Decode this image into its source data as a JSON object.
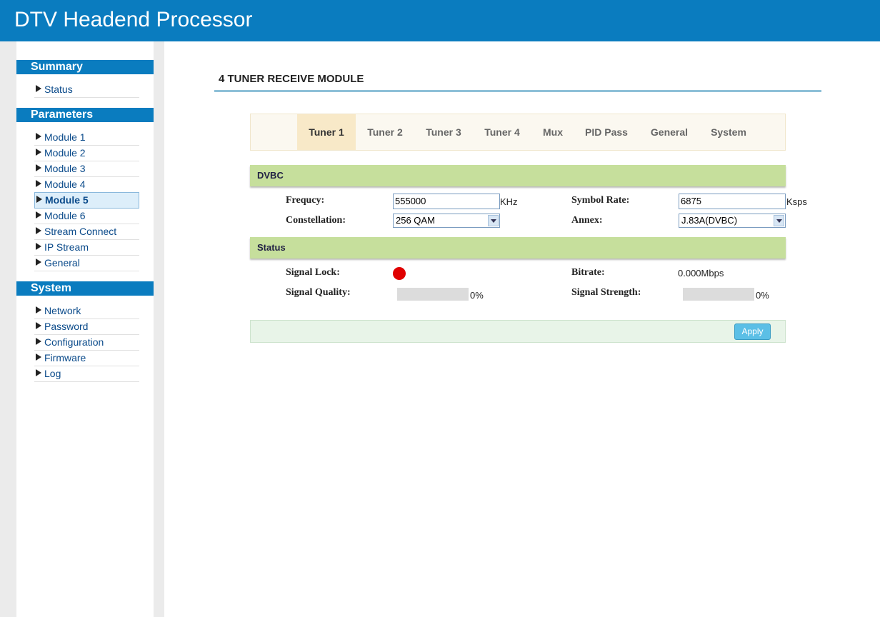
{
  "header": {
    "title": "DTV Headend Processor"
  },
  "sidebar": {
    "summary_title": "Summary",
    "summary_items": [
      {
        "label": "Status"
      }
    ],
    "parameters_title": "Parameters",
    "parameters_items": [
      {
        "label": "Module 1"
      },
      {
        "label": "Module 2"
      },
      {
        "label": "Module 3"
      },
      {
        "label": "Module 4"
      },
      {
        "label": "Module 5",
        "active": true
      },
      {
        "label": "Module 6"
      },
      {
        "label": "Stream Connect"
      },
      {
        "label": "IP Stream"
      },
      {
        "label": "General"
      }
    ],
    "system_title": "System",
    "system_items": [
      {
        "label": "Network"
      },
      {
        "label": "Password"
      },
      {
        "label": "Configuration"
      },
      {
        "label": "Firmware"
      },
      {
        "label": "Log"
      }
    ]
  },
  "main": {
    "page_title": "4 TUNER RECEIVE MODULE",
    "tabs": [
      {
        "label": "Tuner 1",
        "active": true
      },
      {
        "label": "Tuner 2"
      },
      {
        "label": "Tuner 3"
      },
      {
        "label": "Tuner 4"
      },
      {
        "label": "Mux"
      },
      {
        "label": "PID Pass"
      },
      {
        "label": "General"
      },
      {
        "label": "System"
      }
    ],
    "dvbc": {
      "title": "DVBC",
      "frequency_label": "Frequcy:",
      "frequency_value": "555000",
      "frequency_unit": "KHz",
      "symbol_rate_label": "Symbol Rate:",
      "symbol_rate_value": "6875",
      "symbol_rate_unit": "Ksps",
      "constellation_label": "Constellation:",
      "constellation_value": "256 QAM",
      "annex_label": "Annex:",
      "annex_value": "J.83A(DVBC)"
    },
    "status": {
      "title": "Status",
      "signal_lock_label": "Signal Lock:",
      "signal_lock_color": "#e00000",
      "bitrate_label": "Bitrate:",
      "bitrate_value": "0.000Mbps",
      "signal_quality_label": "Signal Quality:",
      "signal_quality_value": "0%",
      "signal_quality_level": 0,
      "signal_strength_label": "Signal Strength:",
      "signal_strength_value": "0%",
      "signal_strength_level": 0
    },
    "apply_label": "Apply"
  },
  "colors": {
    "brand": "#0a7cbf",
    "panel_head": "#c6df9c",
    "active_tab": "#f8e9c8"
  }
}
